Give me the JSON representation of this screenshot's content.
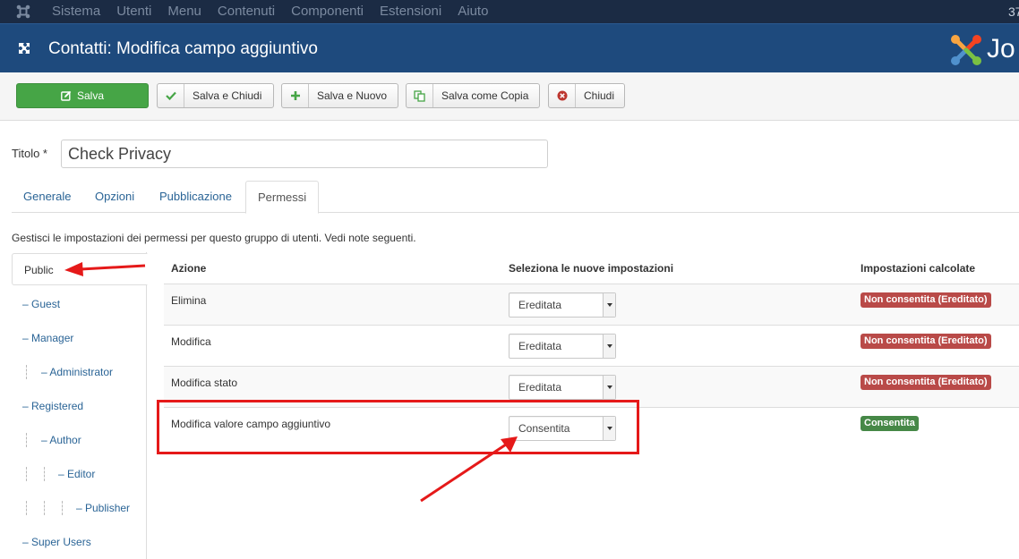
{
  "topbar": {
    "menu": [
      "Sistema",
      "Utenti",
      "Menu",
      "Contenuti",
      "Componenti",
      "Estensioni",
      "Aiuto"
    ],
    "clock_partial": "37"
  },
  "header": {
    "title": "Contatti: Modifica campo aggiuntivo",
    "brand_partial": "Jo"
  },
  "toolbar": {
    "save": "Salva",
    "save_close": "Salva e Chiudi",
    "save_new": "Salva e Nuovo",
    "save_copy": "Salva come Copia",
    "close": "Chiudi"
  },
  "form": {
    "title_label": "Titolo *",
    "title_value": "Check Privacy"
  },
  "tabs": [
    "Generale",
    "Opzioni",
    "Pubblicazione",
    "Permessi"
  ],
  "active_tab": "Permessi",
  "permissions": {
    "intro": "Gestisci le impostazioni dei permessi per questo gruppo di utenti. Vedi note seguenti.",
    "headers": {
      "action": "Azione",
      "new_setting": "Seleziona le nuove impostazioni",
      "calculated": "Impostazioni calcolate"
    },
    "rows": [
      {
        "action": "Elimina",
        "setting": "Ereditata",
        "calculated": "Non consentita (Ereditato)",
        "calculated_color": "#b94a48"
      },
      {
        "action": "Modifica",
        "setting": "Ereditata",
        "calculated": "Non consentita (Ereditato)",
        "calculated_color": "#b94a48"
      },
      {
        "action": "Modifica stato",
        "setting": "Ereditata",
        "calculated": "Non consentita (Ereditato)",
        "calculated_color": "#b94a48"
      },
      {
        "action": "Modifica valore campo aggiuntivo",
        "setting": "Consentita",
        "calculated": "Consentita",
        "calculated_color": "#468847"
      }
    ]
  },
  "groups": {
    "selected": "Public",
    "items": [
      {
        "label": "– Guest",
        "level": 1
      },
      {
        "label": "– Manager",
        "level": 1
      },
      {
        "label": "– Administrator",
        "level": 2
      },
      {
        "label": "– Registered",
        "level": 1
      },
      {
        "label": "– Author",
        "level": 2
      },
      {
        "label": "– Editor",
        "level": 3
      },
      {
        "label": "– Publisher",
        "level": 4
      },
      {
        "label": "– Super Users",
        "level": 1
      }
    ]
  },
  "colors": {
    "topbar": "#1b2b44",
    "header": "#1e4a7d",
    "save_button": "#46a546",
    "link": "#2a6496",
    "annotation": "#e51919"
  },
  "icons": {
    "save": "pencil-square-icon",
    "save_close": "check-icon",
    "save_new": "plus-icon",
    "save_copy": "copy-icon",
    "close": "cancel-circle-icon"
  }
}
